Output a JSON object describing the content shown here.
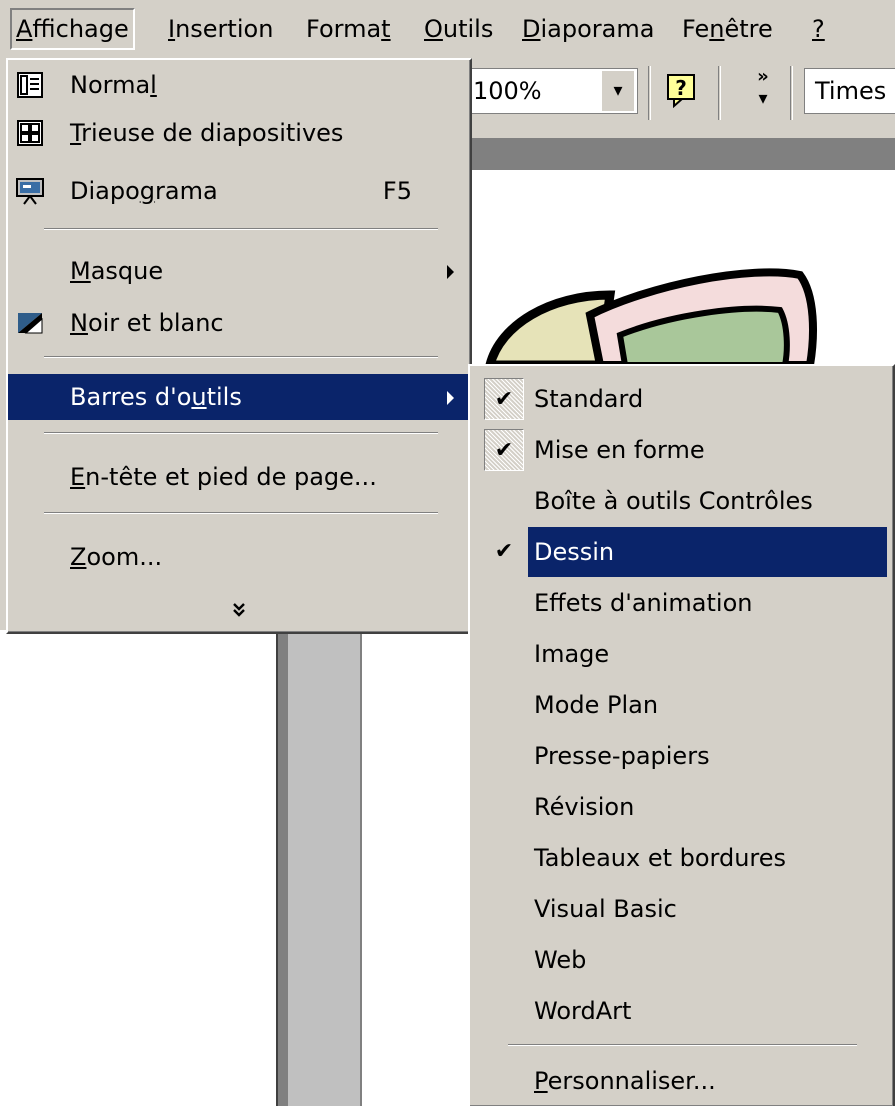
{
  "menubar": {
    "items": [
      {
        "pre": "",
        "key": "A",
        "post": "ffichage"
      },
      {
        "pre": "",
        "key": "I",
        "post": "nsertion"
      },
      {
        "pre": "Forma",
        "key": "t",
        "post": ""
      },
      {
        "pre": "",
        "key": "O",
        "post": "utils"
      },
      {
        "pre": "",
        "key": "D",
        "post": "iaporama"
      },
      {
        "pre": "Fe",
        "key": "n",
        "post": "être"
      },
      {
        "pre": "",
        "key": "?",
        "post": ""
      }
    ]
  },
  "toolbar": {
    "zoom_value": "100%",
    "more_glyph": "»",
    "font_value": "Times N"
  },
  "view_menu": {
    "items": [
      {
        "pre": "Norma",
        "key": "l",
        "post": "",
        "icon": "normal-view-icon"
      },
      {
        "pre": "",
        "key": "T",
        "post": "rieuse de diapositives",
        "icon": "slide-sorter-icon"
      },
      {
        "pre": "Diapo",
        "key": "g",
        "post": "rama",
        "shortcut": "F5",
        "icon": "slideshow-icon"
      },
      {
        "pre": "",
        "key": "M",
        "post": "asque"
      },
      {
        "pre": "",
        "key": "N",
        "post": "oir et blanc",
        "icon": "black-white-icon"
      },
      {
        "pre": "Barres d'o",
        "key": "u",
        "post": "tils"
      },
      {
        "pre": "",
        "key": "E",
        "post": "n-tête et pied de page..."
      },
      {
        "pre": "",
        "key": "Z",
        "post": "oom..."
      }
    ],
    "expand_glyph": "¥"
  },
  "toolbars_menu": {
    "items": [
      {
        "label": "Standard",
        "checked": true
      },
      {
        "label": "Mise en forme",
        "checked": true
      },
      {
        "label": "Boîte à outils Contrôles",
        "checked": false
      },
      {
        "label": "Dessin",
        "checked": true
      },
      {
        "label": "Effets d'animation",
        "checked": false
      },
      {
        "label": "Image",
        "checked": false
      },
      {
        "label": "Mode Plan",
        "checked": false
      },
      {
        "label": "Presse-papiers",
        "checked": false
      },
      {
        "label": "Révision",
        "checked": false
      },
      {
        "label": "Tableaux et bordures",
        "checked": false
      },
      {
        "label": "Visual Basic",
        "checked": false
      },
      {
        "label": "Web",
        "checked": false
      },
      {
        "label": "WordArt",
        "checked": false
      }
    ],
    "customize": {
      "pre": "",
      "key": "P",
      "post": "ersonnaliser..."
    },
    "check_glyph": "✔"
  },
  "colors": {
    "face": "#d4d0c8",
    "highlight": "#0a246a",
    "shadow": "#808080"
  }
}
